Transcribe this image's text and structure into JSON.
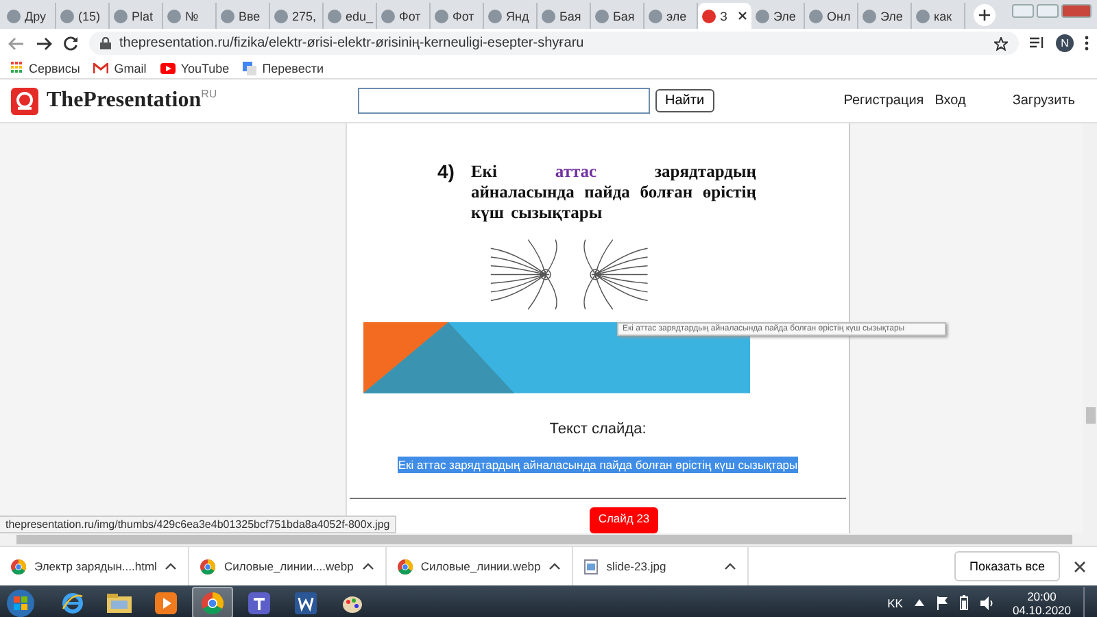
{
  "browser": {
    "tabs": [
      {
        "label": "Дру",
        "selected": false
      },
      {
        "label": "(15)",
        "selected": false
      },
      {
        "label": "Plat",
        "selected": false
      },
      {
        "label": "№",
        "selected": false
      },
      {
        "label": "Вве",
        "selected": false
      },
      {
        "label": "275,",
        "selected": false
      },
      {
        "label": "edu_",
        "selected": false
      },
      {
        "label": "Фот",
        "selected": false
      },
      {
        "label": "Фот",
        "selected": false
      },
      {
        "label": "Янд",
        "selected": false
      },
      {
        "label": "Бая",
        "selected": false
      },
      {
        "label": "Бая",
        "selected": false
      },
      {
        "label": "эле",
        "selected": false
      },
      {
        "label": "З",
        "selected": true
      },
      {
        "label": "Эле",
        "selected": false
      },
      {
        "label": "Онл",
        "selected": false
      },
      {
        "label": "Эле",
        "selected": false
      },
      {
        "label": "как",
        "selected": false
      }
    ],
    "url": "thepresentation.ru/fizika/elektr-ørisi-elektr-ørisiniң-kerneuligi-esepter-shyғaru",
    "profile": "N",
    "bookmarks": [
      "Сервисы",
      "Gmail",
      "YouTube",
      "Перевести"
    ]
  },
  "site": {
    "logo": "ThePresentation$^{RU}$",
    "search_button": "Найти",
    "links": [
      "Регистрация",
      "Вход"
    ],
    "upload": "Загрузить"
  },
  "slide": {
    "number": "4)",
    "heading_parts": [
      {
        "text": "Екі ",
        "highlight": false
      },
      {
        "text": "аттас",
        "highlight": true
      },
      {
        "text": " зарядтардың айналасында пайда болған өрістің күш сызықтары",
        "highlight": false
      }
    ],
    "tooltip": "Екі аттас зарядтардың айналасында пайда болған өрістің күш сызықтары"
  },
  "page": {
    "text_title": "Текст слайда:",
    "slide_text": "Екі аттас зарядтардың айналасында пайда болған өрістің күш сызықтары",
    "slide_button": "Слайд 23"
  },
  "status_bar": "thepresentation.ru/img/thumbs/429c6ea3e4b01325bcf751bda8a4052f-800x.jpg",
  "downloads": {
    "items": [
      {
        "name": "Электр зарядын....html",
        "kind": "chrome"
      },
      {
        "name": "Силовые_линии....webp",
        "kind": "chrome"
      },
      {
        "name": "Силовые_линии.webp",
        "kind": "chrome"
      },
      {
        "name": "slide-23.jpg",
        "kind": "image"
      }
    ],
    "show_all": "Показать все"
  },
  "taskbar": {
    "apps": [
      {
        "kind": "ie",
        "selected": false
      },
      {
        "kind": "folder",
        "selected": false
      },
      {
        "kind": "media",
        "selected": false
      },
      {
        "kind": "chrome",
        "selected": true
      },
      {
        "kind": "teams",
        "selected": false
      },
      {
        "kind": "word",
        "selected": false
      },
      {
        "kind": "paint",
        "selected": false
      }
    ],
    "language": "KK",
    "time": "20:00",
    "date": "04.10.2020"
  }
}
